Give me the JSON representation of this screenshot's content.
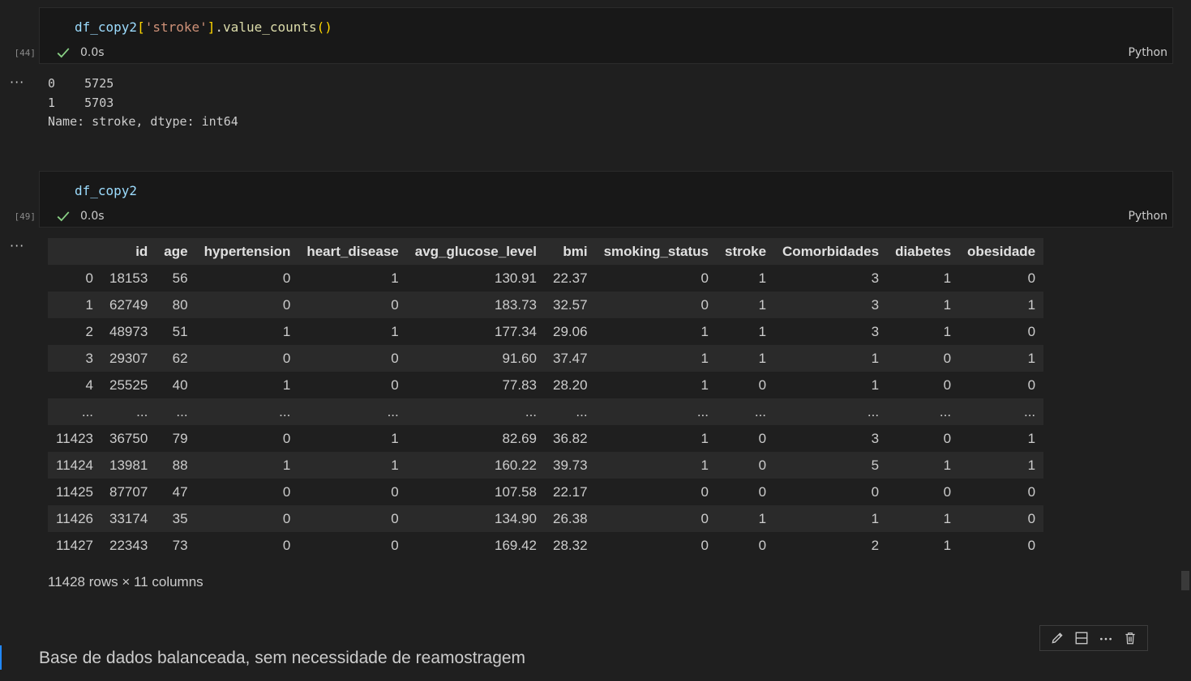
{
  "cells": [
    {
      "exec_count": "[44]",
      "code": {
        "var": "df_copy2",
        "open": "[",
        "str": "'stroke'",
        "close": "]",
        "dot": ".",
        "fn": "value_counts",
        "paren": "()"
      },
      "duration": "0.0s",
      "language": "Python",
      "output": "0    5725\n1    5703\nName: stroke, dtype: int64"
    },
    {
      "exec_count": "[49]",
      "code": {
        "var": "df_copy2"
      },
      "duration": "0.0s",
      "language": "Python"
    }
  ],
  "dataframe": {
    "columns": [
      "",
      "id",
      "age",
      "hypertension",
      "heart_disease",
      "avg_glucose_level",
      "bmi",
      "smoking_status",
      "stroke",
      "Comorbidades",
      "diabetes",
      "obesidade"
    ],
    "rows": [
      [
        "0",
        "18153",
        "56",
        "0",
        "1",
        "130.91",
        "22.37",
        "0",
        "1",
        "3",
        "1",
        "0"
      ],
      [
        "1",
        "62749",
        "80",
        "0",
        "0",
        "183.73",
        "32.57",
        "0",
        "1",
        "3",
        "1",
        "1"
      ],
      [
        "2",
        "48973",
        "51",
        "1",
        "1",
        "177.34",
        "29.06",
        "1",
        "1",
        "3",
        "1",
        "0"
      ],
      [
        "3",
        "29307",
        "62",
        "0",
        "0",
        "91.60",
        "37.47",
        "1",
        "1",
        "1",
        "0",
        "1"
      ],
      [
        "4",
        "25525",
        "40",
        "1",
        "0",
        "77.83",
        "28.20",
        "1",
        "0",
        "1",
        "0",
        "0"
      ],
      [
        "...",
        "...",
        "...",
        "...",
        "...",
        "...",
        "...",
        "...",
        "...",
        "...",
        "...",
        "..."
      ],
      [
        "11423",
        "36750",
        "79",
        "0",
        "1",
        "82.69",
        "36.82",
        "1",
        "0",
        "3",
        "0",
        "1"
      ],
      [
        "11424",
        "13981",
        "88",
        "1",
        "1",
        "160.22",
        "39.73",
        "1",
        "0",
        "5",
        "1",
        "1"
      ],
      [
        "11425",
        "87707",
        "47",
        "0",
        "0",
        "107.58",
        "22.17",
        "0",
        "0",
        "0",
        "0",
        "0"
      ],
      [
        "11426",
        "33174",
        "35",
        "0",
        "0",
        "134.90",
        "26.38",
        "0",
        "1",
        "1",
        "1",
        "0"
      ],
      [
        "11427",
        "22343",
        "73",
        "0",
        "0",
        "169.42",
        "28.32",
        "0",
        "0",
        "2",
        "1",
        "0"
      ]
    ],
    "shape": "11428 rows × 11 columns"
  },
  "markdown": {
    "text": "Base de dados balanceada, sem necessidade de reamostragem"
  },
  "toolbar": {
    "icons": [
      "pencil-icon",
      "split-cell-icon",
      "more-icon",
      "trash-icon"
    ]
  },
  "colors": {
    "accent": "#2188ff",
    "success": "#89d185",
    "string": "#ce9178",
    "variable": "#9cdcfe",
    "function": "#dcdcaa",
    "bracket": "#ffd700"
  }
}
